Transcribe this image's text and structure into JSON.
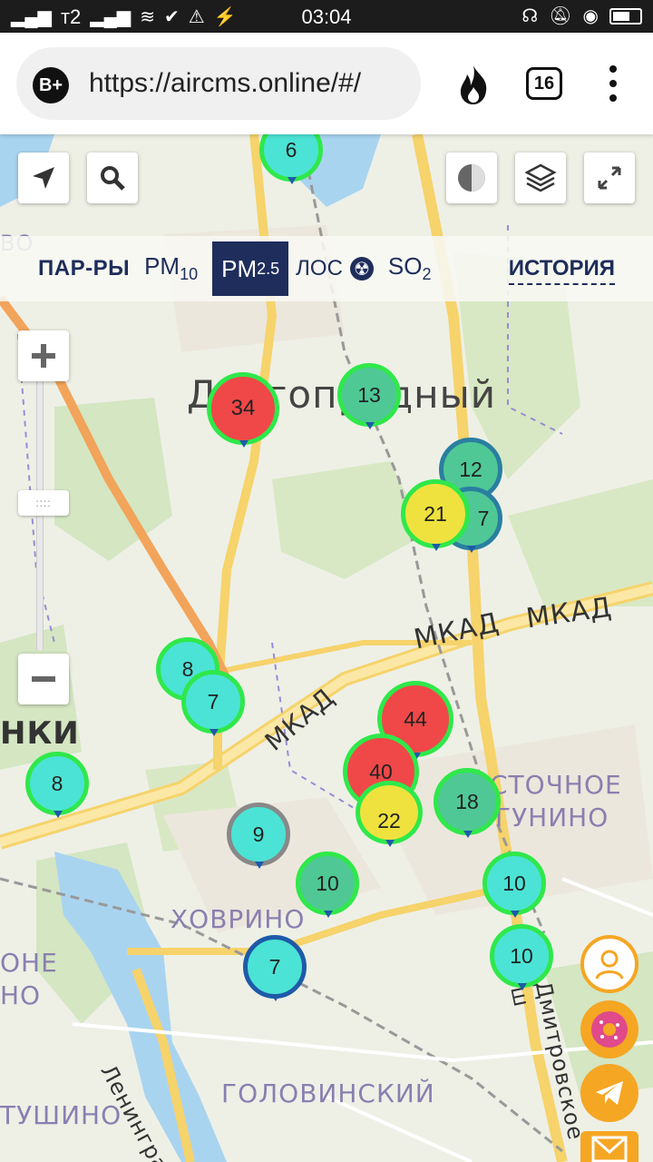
{
  "statusbar": {
    "clock": "03:04",
    "carrier": "т2"
  },
  "browser": {
    "url": "https://aircms.online/#/",
    "tab_count": "16",
    "badge": "B+"
  },
  "params": {
    "label": "ПАР-РЫ",
    "pm10": "PM",
    "pm10_sub": "10",
    "pm25": "PM",
    "pm25_sub": "2.5",
    "los": "ЛОС",
    "so2": "SO",
    "so2_sub": "2",
    "history": "ИСТОРИЯ"
  },
  "zoom": {
    "knob": "::::"
  },
  "map_labels": {
    "dolgoprudny": "Долгопрудный",
    "mkad1": "МКАД",
    "mkad2": "МКАД",
    "mkad3": "МКАД",
    "khovrino": "ХОВРИНО",
    "golovinsky": "ГОЛОВИНСКИЙ",
    "vostochnoe": "СТОЧНОЕ",
    "degunino": "ГУНИНО",
    "tushino": "ТУШИНО",
    "khimki": "НКИ",
    "one": "ОНЕ",
    "one2": "НО",
    "leningradskoe": "Ленинградск",
    "dmitrovskoe": "Дмитровское ш",
    "vo": "ВО"
  },
  "markers": [
    {
      "value": "6"
    },
    {
      "value": "34"
    },
    {
      "value": "13"
    },
    {
      "value": "12"
    },
    {
      "value": "7"
    },
    {
      "value": "21"
    },
    {
      "value": "8"
    },
    {
      "value": "7"
    },
    {
      "value": "44"
    },
    {
      "value": "40"
    },
    {
      "value": "22"
    },
    {
      "value": "18"
    },
    {
      "value": "8"
    },
    {
      "value": "9"
    },
    {
      "value": "10"
    },
    {
      "value": "10"
    },
    {
      "value": "10"
    },
    {
      "value": "7"
    }
  ],
  "colors": {
    "accent": "#1f2d5c",
    "fab": "#f5a623",
    "marker_ring": "#2fe84a"
  }
}
